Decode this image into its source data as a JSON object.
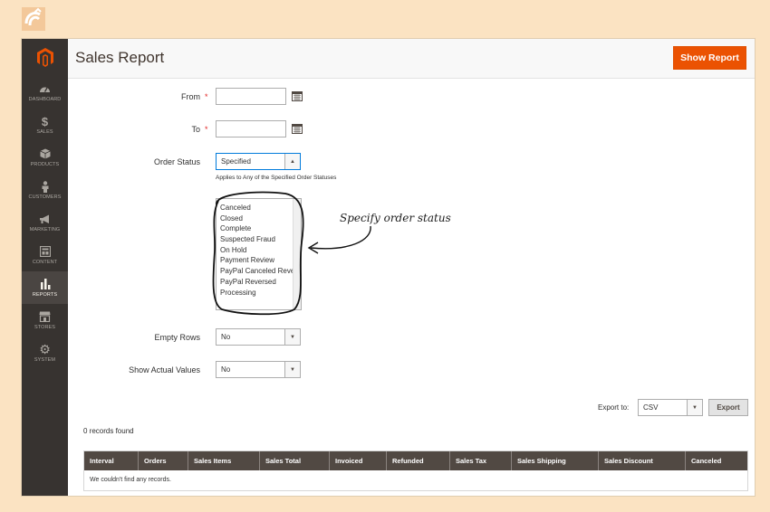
{
  "colors": {
    "page_background": "#fbe3c2",
    "sidebar": "#373330",
    "accent": "#eb5202",
    "grid_header": "#514943",
    "required": "#e22626"
  },
  "corner_logo": "corner-logo-icon",
  "sidebar": {
    "logo": "magento-logo-icon",
    "items": [
      {
        "label": "DASHBOARD",
        "icon": "dashboard-icon",
        "active": false
      },
      {
        "label": "SALES",
        "icon": "dollar-icon",
        "active": false
      },
      {
        "label": "PRODUCTS",
        "icon": "cube-icon",
        "active": false
      },
      {
        "label": "CUSTOMERS",
        "icon": "person-icon",
        "active": false
      },
      {
        "label": "MARKETING",
        "icon": "megaphone-icon",
        "active": false
      },
      {
        "label": "CONTENT",
        "icon": "layout-icon",
        "active": false
      },
      {
        "label": "REPORTS",
        "icon": "bar-chart-icon",
        "active": true
      },
      {
        "label": "STORES",
        "icon": "store-icon",
        "active": false
      },
      {
        "label": "SYSTEM",
        "icon": "gear-icon",
        "active": false
      }
    ]
  },
  "header": {
    "title": "Sales Report",
    "show_report_label": "Show Report"
  },
  "form": {
    "from_label": "From",
    "from_value": "",
    "to_label": "To",
    "to_value": "",
    "required_mark": "*",
    "order_status_label": "Order Status",
    "order_status_value": "Specified",
    "order_status_hint": "Applies to Any of the Specified Order Statuses",
    "status_options": [
      "Canceled",
      "Closed",
      "Complete",
      "Suspected Fraud",
      "On Hold",
      "Payment Review",
      "PayPal Canceled Reversal",
      "PayPal Reversed",
      "Processing"
    ],
    "empty_rows_label": "Empty Rows",
    "empty_rows_value": "No",
    "show_actual_label": "Show Actual Values",
    "show_actual_value": "No"
  },
  "annotation": {
    "text": "Specify order status"
  },
  "export": {
    "label": "Export to:",
    "format_value": "CSV",
    "button_label": "Export"
  },
  "grid": {
    "records_found": "0 records found",
    "columns": [
      "Interval",
      "Orders",
      "Sales Items",
      "Sales Total",
      "Invoiced",
      "Refunded",
      "Sales Tax",
      "Sales Shipping",
      "Sales Discount",
      "Canceled"
    ],
    "empty_message": "We couldn't find any records."
  }
}
